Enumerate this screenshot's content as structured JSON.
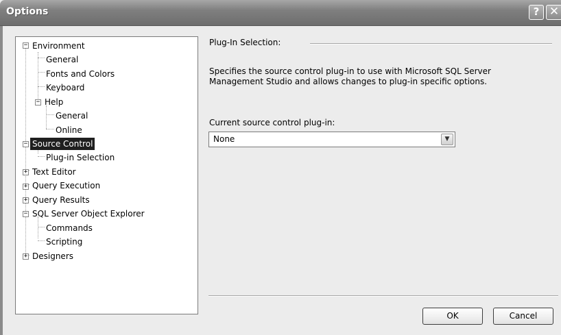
{
  "window": {
    "title": "Options",
    "help_glyph": "?",
    "close_glyph": "✕"
  },
  "tree": {
    "environment": "Environment",
    "env_general": "General",
    "fonts_colors": "Fonts and Colors",
    "keyboard": "Keyboard",
    "help": "Help",
    "help_general": "General",
    "help_online": "Online",
    "source_control": "Source Control",
    "plugin_selection": "Plug-in Selection",
    "text_editor": "Text Editor",
    "query_execution": "Query Execution",
    "query_results": "Query Results",
    "sql_object_explorer": "SQL Server Object Explorer",
    "commands": "Commands",
    "scripting": "Scripting",
    "designers": "Designers",
    "collapse_glyph": "−",
    "expand_glyph": "+"
  },
  "panel": {
    "section_title": "Plug-In Selection:",
    "description": "Specifies the source control plug-in to use with Microsoft SQL Server Management Studio and allows changes to plug-in specific options.",
    "plugin_label": "Current source control plug-in:",
    "plugin_value": "None",
    "dropdown_glyph": "▼"
  },
  "buttons": {
    "ok": "OK",
    "cancel": "Cancel"
  }
}
